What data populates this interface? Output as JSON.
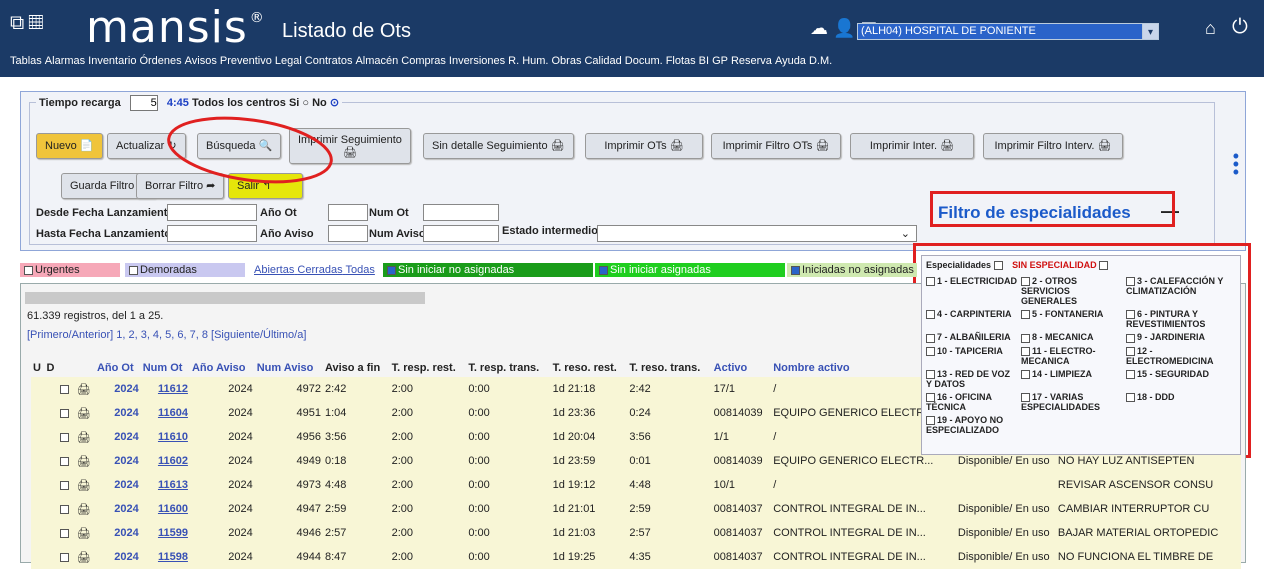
{
  "header": {
    "logo": "mansis",
    "logo_reg": "®",
    "title": "Listado de Ots",
    "hospital": "(ALH04) HOSPITAL DE PONIENTE",
    "menu": [
      "Tablas",
      "Alarmas",
      "Inventario",
      "Órdenes",
      "Avisos",
      "Preventivo",
      "Legal",
      "Contratos",
      "Almacén",
      "Compras",
      "Inversiones",
      "R. Hum.",
      "Obras",
      "Calidad",
      "Docum.",
      "Flotas",
      "BI",
      "GP",
      "Reserva",
      "Ayuda",
      "D.M."
    ]
  },
  "top": {
    "tiempo_label": "Tiempo recarga",
    "tiempo_value": "5",
    "countdown": "4:45",
    "todos_label": "Todos los centros",
    "si": "Si",
    "no": "No"
  },
  "buttons": {
    "nuevo": "Nuevo",
    "actualizar": "Actualizar",
    "busqueda": "Búsqueda",
    "imprimir_seguimiento": "Imprimir Seguimiento",
    "sin_detalle": "Sin detalle Seguimiento",
    "imprimir_ots": "Imprimir OTs",
    "imprimir_filtro_ots": "Imprimir Filtro OTs",
    "imprimir_inter": "Imprimir Inter.",
    "imprimir_filtro_interv": "Imprimir Filtro Interv.",
    "guarda_filtro": "Guarda Filtro",
    "borrar_filtro": "Borrar Filtro",
    "salir": "Salir"
  },
  "fields": {
    "desde": "Desde Fecha Lanzamiento",
    "hasta": "Hasta Fecha Lanzamiento",
    "ano_ot": "Año Ot",
    "ano_aviso": "Año Aviso",
    "num_ot": "Num Ot",
    "num_aviso": "Num Aviso",
    "estado": "Estado intermedio"
  },
  "filtro_title": "Filtro de especialidades",
  "legend_bar": {
    "urgentes": "Urgentes",
    "demoradas": "Demoradas",
    "abiertas": "Abiertas",
    "cerradas": "Cerradas",
    "todas": "Todas",
    "sin_iniciar_no_asig": "Sin iniciar no asignadas",
    "sin_iniciar_asig": "Sin iniciar asignadas",
    "iniciadas_no_asig": "Iniciadas no asignadas"
  },
  "grid": {
    "records": "61.339 registros, del 1 a 25.",
    "pager": "[Primero/Anterior] 1, 2, 3, 4, 5, 6, 7, 8 [Siguiente/Último/a]",
    "headers": [
      "U",
      "D",
      "",
      "",
      "Año Ot",
      "Num Ot",
      "Año Aviso",
      "Num Aviso",
      "Aviso a fin",
      "T. resp. rest.",
      "T. resp. trans.",
      "T. reso. rest.",
      "T. reso. trans.",
      "Activo",
      "Nombre activo",
      "",
      ""
    ],
    "rows": [
      [
        "2024",
        "11612",
        "2024",
        "4972",
        "2:42",
        "2:00",
        "0:00",
        "1d 21:18",
        "2:42",
        "17/1",
        "/",
        "",
        ""
      ],
      [
        "2024",
        "11604",
        "2024",
        "4951",
        "1:04",
        "2:00",
        "0:00",
        "1d 23:36",
        "0:24",
        "00814039",
        "EQUIPO GENERICO ELECTR...",
        "",
        ""
      ],
      [
        "2024",
        "11610",
        "2024",
        "4956",
        "3:56",
        "2:00",
        "0:00",
        "1d 20:04",
        "3:56",
        "1/1",
        "/",
        "",
        ""
      ],
      [
        "2024",
        "11602",
        "2024",
        "4949",
        "0:18",
        "2:00",
        "0:00",
        "1d 23:59",
        "0:01",
        "00814039",
        "EQUIPO GENERICO ELECTR...",
        "Disponible/ En uso",
        "NO HAY LUZ ANTISEPTEN"
      ],
      [
        "2024",
        "11613",
        "2024",
        "4973",
        "4:48",
        "2:00",
        "0:00",
        "1d 19:12",
        "4:48",
        "10/1",
        "/",
        "",
        "REVISAR ASCENSOR CONSU"
      ],
      [
        "2024",
        "11600",
        "2024",
        "4947",
        "2:59",
        "2:00",
        "0:00",
        "1d 21:01",
        "2:59",
        "00814037",
        "CONTROL INTEGRAL DE IN...",
        "Disponible/ En uso",
        "CAMBIAR INTERRUPTOR CU"
      ],
      [
        "2024",
        "11599",
        "2024",
        "4946",
        "2:57",
        "2:00",
        "0:00",
        "1d 21:03",
        "2:57",
        "00814037",
        "CONTROL INTEGRAL DE IN...",
        "Disponible/ En uso",
        "BAJAR MATERIAL ORTOPEDIC"
      ],
      [
        "2024",
        "11598",
        "2024",
        "4944",
        "8:47",
        "2:00",
        "0:00",
        "1d 19:25",
        "4:35",
        "00814037",
        "CONTROL INTEGRAL DE IN...",
        "Disponible/ En uso",
        "NO FUNCIONA EL TIMBRE DE"
      ]
    ]
  },
  "filter_panel": {
    "especialidades": "Especialidades",
    "sin": "SIN ESPECIALIDAD",
    "items": [
      "1 - ELECTRICIDAD",
      "2 - OTROS SERVICIOS GENERALES",
      "3 - CALEFACCIÓN Y CLIMATIZACIÓN",
      "4 - CARPINTERIA",
      "5 - FONTANERIA",
      "6 - PINTURA Y REVESTIMIENTOS",
      "7 - ALBAÑILERIA",
      "8 - MECANICA",
      "9 - JARDINERIA",
      "10 - TAPICERIA",
      "11 - ELECTRO-MECANICA",
      "12 - ELECTROMEDICINA",
      "13 - RED DE VOZ Y DATOS",
      "14 - LIMPIEZA",
      "15 - SEGURIDAD",
      "16 - OFICINA TÉCNICA",
      "17 - VARIAS ESPECIALIDADES",
      "18 - DDD",
      "19 - APOYO NO ESPECIALIZADO"
    ]
  }
}
